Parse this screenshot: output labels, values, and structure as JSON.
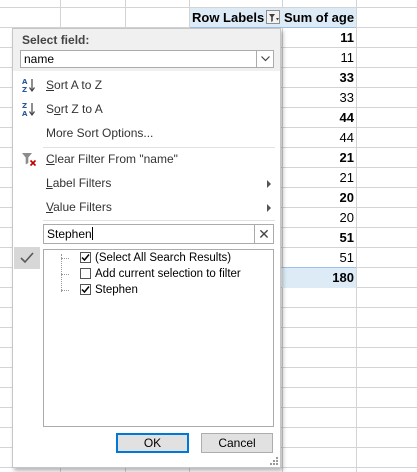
{
  "pivot": {
    "row_labels_header": "Row Labels",
    "value_header": "Sum of age",
    "values": [
      {
        "text": "11",
        "bold": true
      },
      {
        "text": "11",
        "bold": false
      },
      {
        "text": "33",
        "bold": true
      },
      {
        "text": "33",
        "bold": false
      },
      {
        "text": "44",
        "bold": true
      },
      {
        "text": "44",
        "bold": false
      },
      {
        "text": "21",
        "bold": true
      },
      {
        "text": "21",
        "bold": false
      },
      {
        "text": "20",
        "bold": true
      },
      {
        "text": "20",
        "bold": false
      },
      {
        "text": "51",
        "bold": true
      },
      {
        "text": "51",
        "bold": false
      }
    ],
    "grand_total": "180"
  },
  "filter_panel": {
    "select_field_label": "Select field:",
    "selected_field": "name",
    "sort_az_pre": "S",
    "sort_az_post": "ort A to Z",
    "sort_za_pre": "S",
    "sort_za_mid": "o",
    "sort_za_post": "rt Z to A",
    "more_sort_pre": "",
    "more_sort_label": "More Sort Options...",
    "clear_filter_pre": "C",
    "clear_filter_post": "lear Filter From \"name\"",
    "label_filters_pre": "L",
    "label_filters_post": "abel Filters",
    "value_filters_pre": "V",
    "value_filters_post": "alue Filters",
    "search_value": "Stephen",
    "search_clear": "✕",
    "list_items": [
      {
        "label": "(Select All Search Results)",
        "checked": true
      },
      {
        "label": "Add current selection to filter",
        "checked": false
      },
      {
        "label": "Stephen",
        "checked": true
      }
    ],
    "ok_label": "OK",
    "cancel_label": "Cancel"
  },
  "colors": {
    "pivot_header_fill": "#ddebf7",
    "ok_border": "#0078d7",
    "clear_filter_icon": "#c00000"
  },
  "icons": {
    "sort_az": "sort-ascending-icon",
    "sort_za": "sort-descending-icon",
    "clear_filter": "clear-filter-icon",
    "filter_button": "filter-dropdown-icon",
    "checkmark": "checkmark-icon"
  }
}
